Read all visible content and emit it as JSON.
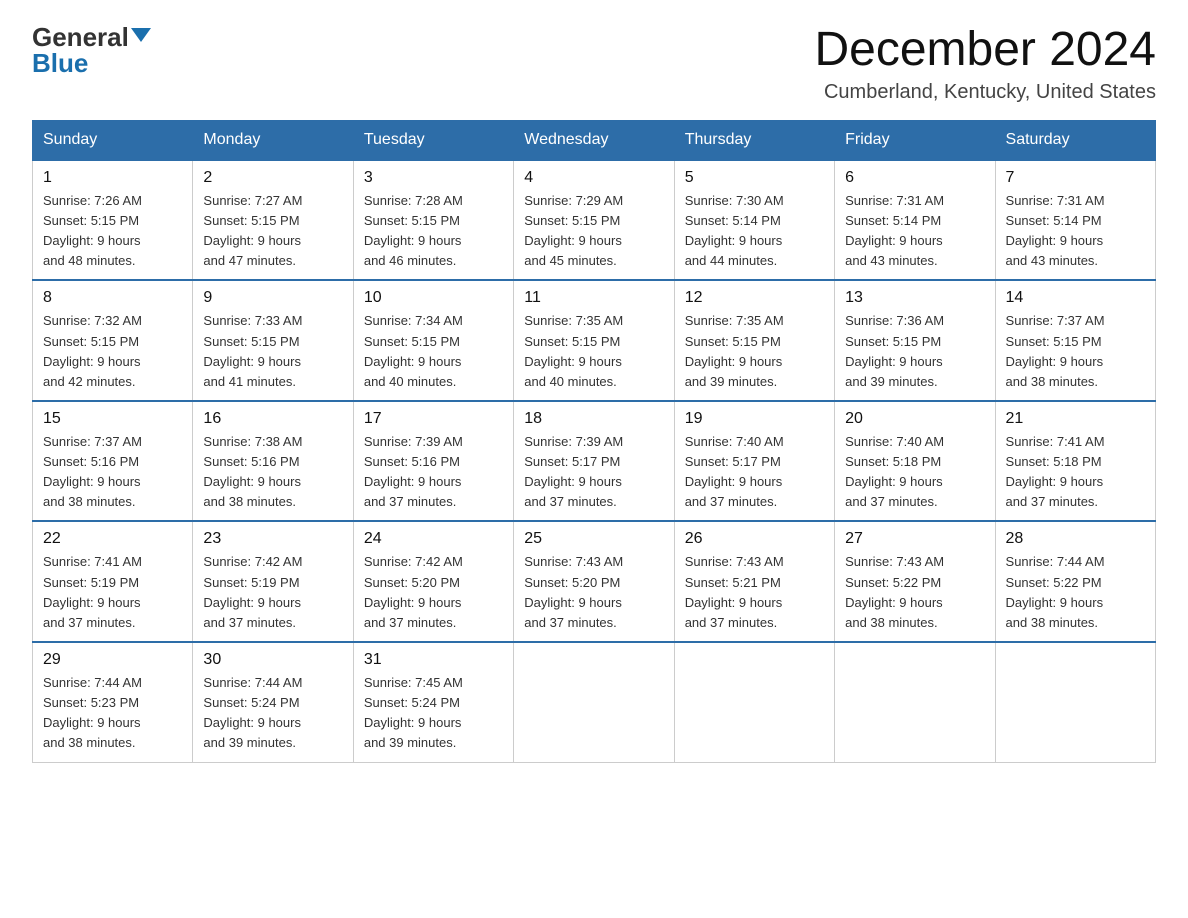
{
  "logo": {
    "general": "General",
    "blue": "Blue"
  },
  "header": {
    "title": "December 2024",
    "subtitle": "Cumberland, Kentucky, United States"
  },
  "weekdays": [
    "Sunday",
    "Monday",
    "Tuesday",
    "Wednesday",
    "Thursday",
    "Friday",
    "Saturday"
  ],
  "weeks": [
    [
      {
        "day": "1",
        "sunrise": "7:26 AM",
        "sunset": "5:15 PM",
        "daylight": "9 hours and 48 minutes."
      },
      {
        "day": "2",
        "sunrise": "7:27 AM",
        "sunset": "5:15 PM",
        "daylight": "9 hours and 47 minutes."
      },
      {
        "day": "3",
        "sunrise": "7:28 AM",
        "sunset": "5:15 PM",
        "daylight": "9 hours and 46 minutes."
      },
      {
        "day": "4",
        "sunrise": "7:29 AM",
        "sunset": "5:15 PM",
        "daylight": "9 hours and 45 minutes."
      },
      {
        "day": "5",
        "sunrise": "7:30 AM",
        "sunset": "5:14 PM",
        "daylight": "9 hours and 44 minutes."
      },
      {
        "day": "6",
        "sunrise": "7:31 AM",
        "sunset": "5:14 PM",
        "daylight": "9 hours and 43 minutes."
      },
      {
        "day": "7",
        "sunrise": "7:31 AM",
        "sunset": "5:14 PM",
        "daylight": "9 hours and 43 minutes."
      }
    ],
    [
      {
        "day": "8",
        "sunrise": "7:32 AM",
        "sunset": "5:15 PM",
        "daylight": "9 hours and 42 minutes."
      },
      {
        "day": "9",
        "sunrise": "7:33 AM",
        "sunset": "5:15 PM",
        "daylight": "9 hours and 41 minutes."
      },
      {
        "day": "10",
        "sunrise": "7:34 AM",
        "sunset": "5:15 PM",
        "daylight": "9 hours and 40 minutes."
      },
      {
        "day": "11",
        "sunrise": "7:35 AM",
        "sunset": "5:15 PM",
        "daylight": "9 hours and 40 minutes."
      },
      {
        "day": "12",
        "sunrise": "7:35 AM",
        "sunset": "5:15 PM",
        "daylight": "9 hours and 39 minutes."
      },
      {
        "day": "13",
        "sunrise": "7:36 AM",
        "sunset": "5:15 PM",
        "daylight": "9 hours and 39 minutes."
      },
      {
        "day": "14",
        "sunrise": "7:37 AM",
        "sunset": "5:15 PM",
        "daylight": "9 hours and 38 minutes."
      }
    ],
    [
      {
        "day": "15",
        "sunrise": "7:37 AM",
        "sunset": "5:16 PM",
        "daylight": "9 hours and 38 minutes."
      },
      {
        "day": "16",
        "sunrise": "7:38 AM",
        "sunset": "5:16 PM",
        "daylight": "9 hours and 38 minutes."
      },
      {
        "day": "17",
        "sunrise": "7:39 AM",
        "sunset": "5:16 PM",
        "daylight": "9 hours and 37 minutes."
      },
      {
        "day": "18",
        "sunrise": "7:39 AM",
        "sunset": "5:17 PM",
        "daylight": "9 hours and 37 minutes."
      },
      {
        "day": "19",
        "sunrise": "7:40 AM",
        "sunset": "5:17 PM",
        "daylight": "9 hours and 37 minutes."
      },
      {
        "day": "20",
        "sunrise": "7:40 AM",
        "sunset": "5:18 PM",
        "daylight": "9 hours and 37 minutes."
      },
      {
        "day": "21",
        "sunrise": "7:41 AM",
        "sunset": "5:18 PM",
        "daylight": "9 hours and 37 minutes."
      }
    ],
    [
      {
        "day": "22",
        "sunrise": "7:41 AM",
        "sunset": "5:19 PM",
        "daylight": "9 hours and 37 minutes."
      },
      {
        "day": "23",
        "sunrise": "7:42 AM",
        "sunset": "5:19 PM",
        "daylight": "9 hours and 37 minutes."
      },
      {
        "day": "24",
        "sunrise": "7:42 AM",
        "sunset": "5:20 PM",
        "daylight": "9 hours and 37 minutes."
      },
      {
        "day": "25",
        "sunrise": "7:43 AM",
        "sunset": "5:20 PM",
        "daylight": "9 hours and 37 minutes."
      },
      {
        "day": "26",
        "sunrise": "7:43 AM",
        "sunset": "5:21 PM",
        "daylight": "9 hours and 37 minutes."
      },
      {
        "day": "27",
        "sunrise": "7:43 AM",
        "sunset": "5:22 PM",
        "daylight": "9 hours and 38 minutes."
      },
      {
        "day": "28",
        "sunrise": "7:44 AM",
        "sunset": "5:22 PM",
        "daylight": "9 hours and 38 minutes."
      }
    ],
    [
      {
        "day": "29",
        "sunrise": "7:44 AM",
        "sunset": "5:23 PM",
        "daylight": "9 hours and 38 minutes."
      },
      {
        "day": "30",
        "sunrise": "7:44 AM",
        "sunset": "5:24 PM",
        "daylight": "9 hours and 39 minutes."
      },
      {
        "day": "31",
        "sunrise": "7:45 AM",
        "sunset": "5:24 PM",
        "daylight": "9 hours and 39 minutes."
      },
      null,
      null,
      null,
      null
    ]
  ],
  "labels": {
    "sunrise": "Sunrise:",
    "sunset": "Sunset:",
    "daylight": "Daylight:"
  }
}
